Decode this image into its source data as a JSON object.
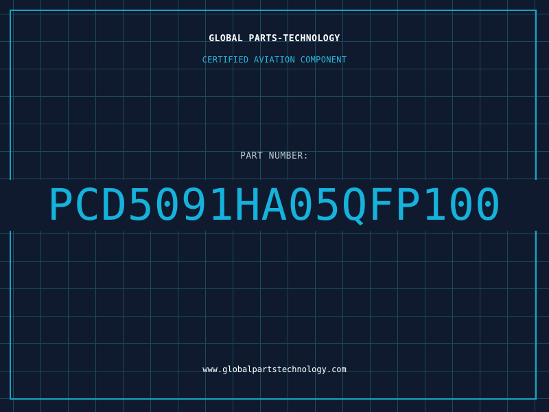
{
  "header": {
    "company": "GLOBAL PARTS-TECHNOLOGY",
    "tagline": "CERTIFIED AVIATION COMPONENT"
  },
  "part": {
    "label": "PART NUMBER:",
    "number": "PCD5091HA05QFP100"
  },
  "footer": {
    "website": "www.globalpartstechnology.com"
  },
  "colors": {
    "background": "#0f1a2e",
    "grid": "#1b4a5e",
    "accent": "#16b2dc",
    "frame": "#1aa3c4"
  }
}
